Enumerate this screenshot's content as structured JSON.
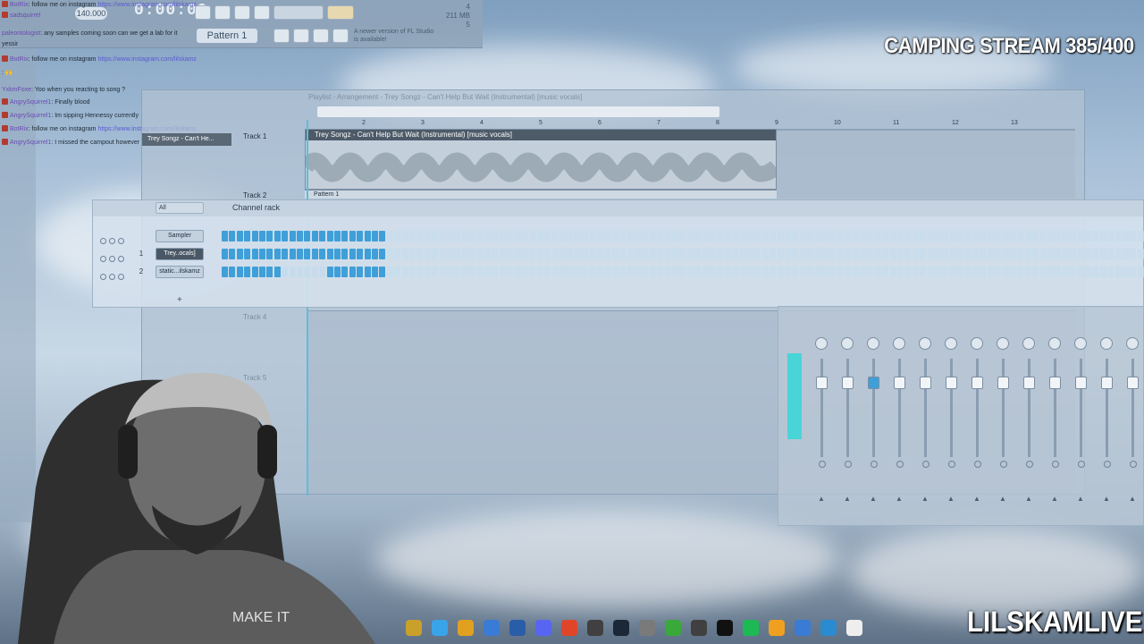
{
  "fl_studio": {
    "time": "0:00:09",
    "tempo": "140.000",
    "pattern": "Pattern 1",
    "cpu": [
      "4",
      "211 MB",
      "5"
    ],
    "update_notice": "A newer version of FL Studio is available!"
  },
  "chat": [
    {
      "user": "BotRix",
      "text": ": follow me on instagram",
      "link": "https://www.instagram.com/lilskamz"
    },
    {
      "user": "sadsquirrel",
      "text": ""
    },
    {
      "user": "paleontologist",
      "text": ": any samples coming soon can we get a lab for it"
    },
    {
      "user": "",
      "text": "yessir"
    },
    {
      "user": "BotRix",
      "text": ": follow me on instagram",
      "link": "https://www.instagram.com/lilskamz"
    },
    {
      "user": "",
      "text": ": 🙌"
    },
    {
      "user": "YxkmFoxe",
      "text": ": Yoo when you reacting to song ?"
    },
    {
      "user": "AngrySquirrel1",
      "text": ": Finally blood"
    },
    {
      "user": "AngrySquirrel1",
      "text": ": Im sipping Hennessy currently"
    },
    {
      "user": "BotRix",
      "text": ": follow me on instagram",
      "link": "https://www.instagram.com/lilskamz"
    },
    {
      "user": "AngrySquirrel1",
      "text": ": I missed the campout however slime"
    }
  ],
  "playlist": {
    "title": "Playlist - Arrangement - Trey Songz - Can't Help But Wait (Instrumental) [music vocals]",
    "ruler": [
      "2",
      "3",
      "4",
      "5",
      "6",
      "7",
      "8",
      "9",
      "10",
      "11",
      "12",
      "13"
    ],
    "tracks": [
      "Track 1",
      "Track 2",
      "Track 4",
      "Track 5"
    ],
    "audio_clip": "Trey Songz - Can't Help But Wait (Instrumental) [music vocals]",
    "pattern_clip": "Pattern 1",
    "picker_clip": "Trey Songz - Can't He..."
  },
  "channel_rack": {
    "title": "Channel rack",
    "filter": "All",
    "channels": [
      {
        "num": "",
        "name": "Sampler",
        "selected": false
      },
      {
        "num": "1",
        "name": "Trey..ocals]",
        "selected": true
      },
      {
        "num": "2",
        "name": "static...ilskamz",
        "selected": false
      }
    ]
  },
  "stream": {
    "title": "CAMPING STREAM 385/400",
    "channel": "LILSKAMLIVE"
  },
  "colors": {
    "step_on": "#3f9fd8",
    "step_off": "#c6dcec",
    "meter": "#49d4d8",
    "clip_header": "#4d5a68"
  },
  "taskbar_icons": [
    "folder-icon",
    "chrome-icon",
    "file-explorer-icon",
    "store-icon",
    "photoshop-icon",
    "discord-icon",
    "brave-icon",
    "obs-icon",
    "steam-icon",
    "keyboard-icon",
    "xbox-icon",
    "4k-icon",
    "capcut-icon",
    "spotify-icon",
    "fl-studio-icon",
    "notepad-icon",
    "photos-icon",
    "file-icon"
  ]
}
